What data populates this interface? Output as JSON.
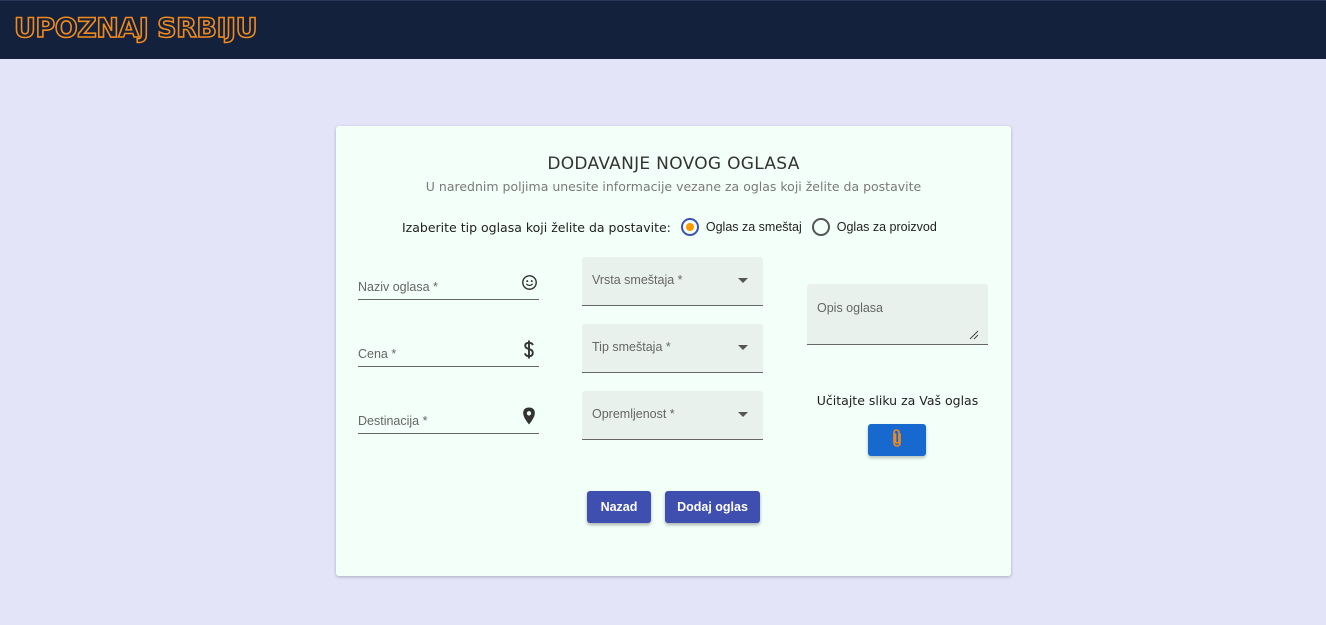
{
  "header": {
    "logo_text": "UPOZNAJ SRBIJU"
  },
  "form": {
    "title": "DODAVANJE NOVOG OGLASA",
    "subtitle": "U narednim poljima unesite informacije vezane za oglas koji želite da postavite",
    "type_prompt": "Izaberite tip oglasa koji želite da postavite:",
    "type_options": [
      {
        "label": "Oglas za smeštaj",
        "selected": true
      },
      {
        "label": "Oglas za proizvod",
        "selected": false
      }
    ],
    "fields": {
      "naziv": {
        "label": "Naziv oglasa *",
        "icon": "smiley-icon"
      },
      "cena": {
        "label": "Cena *",
        "icon": "dollar-icon"
      },
      "destinacija": {
        "label": "Destinacija *",
        "icon": "location-pin-icon"
      }
    },
    "selects": {
      "vrsta": {
        "label": "Vrsta smeštaja *"
      },
      "tip": {
        "label": "Tip smeštaja *"
      },
      "opremljenost": {
        "label": "Opremljenost *"
      }
    },
    "description": {
      "label": "Opis oglasa"
    },
    "upload": {
      "label": "Učitajte sliku za Vaš oglas",
      "icon": "paperclip-icon"
    },
    "buttons": {
      "back": "Nazad",
      "add": "Dodaj oglas"
    }
  },
  "colors": {
    "header_bg": "#14213d",
    "logo_orange": "#f08a1c",
    "page_bg": "#e4e4f9",
    "card_bg": "#f3fff9",
    "primary_button": "#3f4fb0",
    "upload_button": "#1769d0",
    "radio_dot": "#ff9800"
  }
}
